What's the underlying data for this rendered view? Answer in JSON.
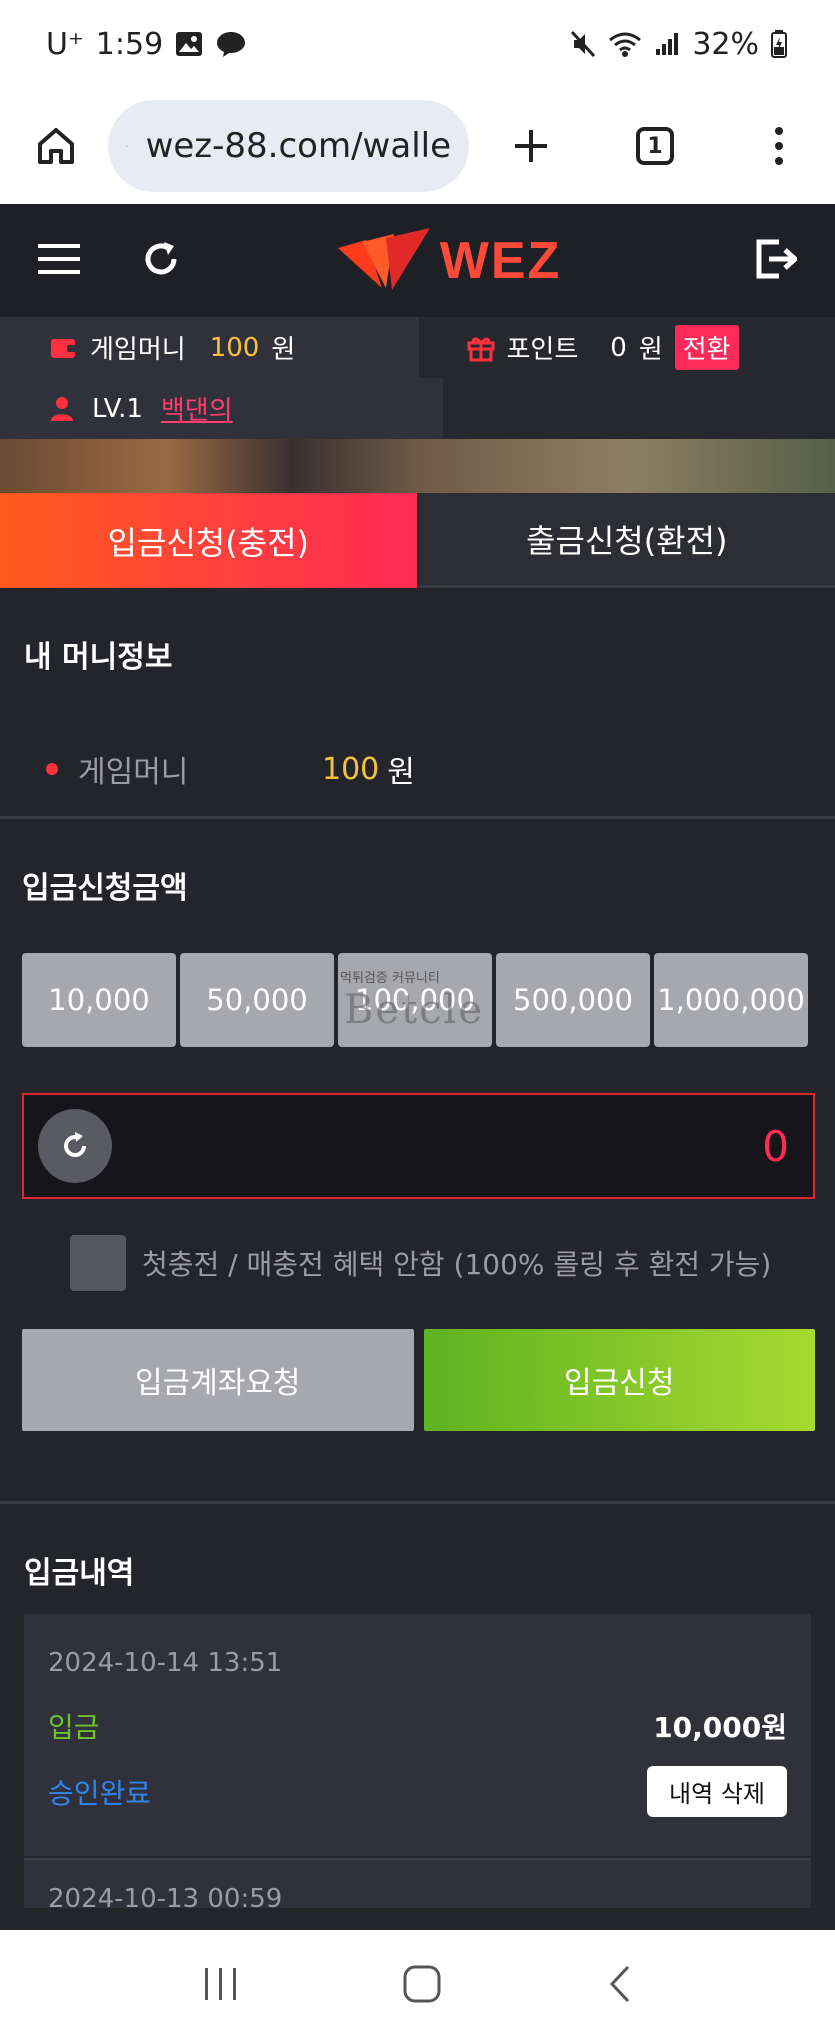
{
  "status": {
    "carrier": "U⁺",
    "time": "1:59",
    "battery": "32%"
  },
  "browser": {
    "url": "wez-88.com/walle",
    "tab_count": "1"
  },
  "header": {
    "logo_text": "WEZ"
  },
  "account": {
    "game_money_label": "게임머니",
    "game_money_value": "100",
    "game_money_unit": "원",
    "point_label": "포인트",
    "point_value": "0",
    "point_unit": "원",
    "convert_label": "전환",
    "level": "LV.1",
    "username": "백댄의"
  },
  "tabs": {
    "deposit": "입금신청(충전)",
    "withdraw": "출금신청(환전)"
  },
  "money_info": {
    "title": "내 머니정보",
    "label": "게임머니",
    "value": "100",
    "unit": "원"
  },
  "deposit_form": {
    "title": "입금신청금액",
    "amounts": [
      "10,000",
      "50,000",
      "100,000",
      "500,000",
      "1,000,000"
    ],
    "watermark_small": "먹튀검증 커뮤니티",
    "watermark_big": "Betcle",
    "input_value": "0",
    "checkbox_label": "첫충전 / 매충전 혜택 안함 (100% 롤링 후 환전 가능)",
    "account_request_button": "입금계좌요청",
    "submit_button": "입금신청"
  },
  "history": {
    "title": "입금내역",
    "items": [
      {
        "date": "2024-10-14 13:51",
        "type": "입금",
        "amount": "10,000원",
        "status": "승인완료",
        "delete": "내역 삭제"
      },
      {
        "date": "2024-10-13 00:59"
      }
    ]
  },
  "colors": {
    "accent": "#ff2a55",
    "money": "#f6c23e",
    "green": "#6fc22f",
    "blue": "#2f86f0"
  }
}
